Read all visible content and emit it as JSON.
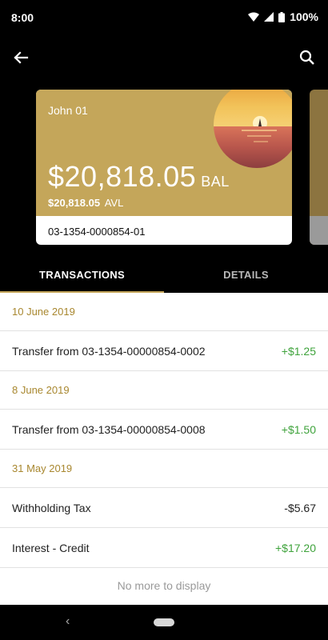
{
  "status_bar": {
    "time": "8:00",
    "battery": "100%"
  },
  "app_bar": {
    "back_icon": "arrow-left-icon",
    "search_icon": "search-icon"
  },
  "card": {
    "name": "John 01",
    "balance": "$20,818.05",
    "balance_label": "BAL",
    "available": "$20,818.05",
    "available_label": "AVL",
    "account_number": "03-1354-0000854-01",
    "accent_color": "#c4a65a"
  },
  "tabs": [
    {
      "label": "TRANSACTIONS",
      "selected": true
    },
    {
      "label": "DETAILS",
      "selected": false
    }
  ],
  "groups": [
    {
      "date": "10 June 2019",
      "transactions": [
        {
          "description": "Transfer from 03-1354-00000854-0002",
          "amount": "+$1.25"
        }
      ]
    },
    {
      "date": "8 June 2019",
      "transactions": [
        {
          "description": "Transfer from 03-1354-00000854-0008",
          "amount": "+$1.50"
        }
      ]
    },
    {
      "date": "31 May 2019",
      "transactions": [
        {
          "description": "Withholding Tax",
          "amount": "-$5.67"
        },
        {
          "description": "Interest - Credit",
          "amount": "+$17.20"
        }
      ]
    }
  ],
  "footer_text": "No more to display",
  "colors": {
    "positive": "#3fa33c",
    "date_header": "#a8872f"
  }
}
